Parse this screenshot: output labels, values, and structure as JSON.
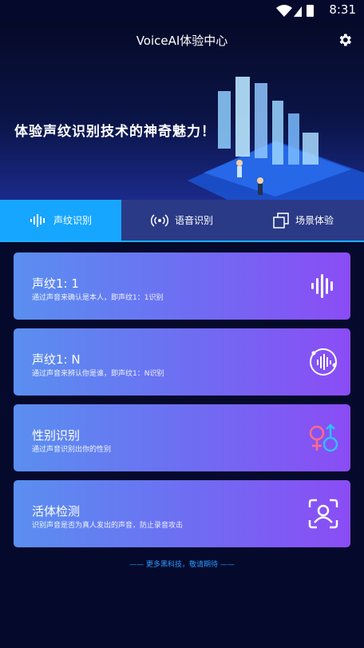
{
  "status": {
    "time": "8:31"
  },
  "header": {
    "title": "VoiceAI体验中心",
    "banner_text": "体验声纹识别技术的神奇魅力！"
  },
  "tabs": [
    {
      "label": "声纹识别",
      "icon": "soundwave-icon",
      "active": true
    },
    {
      "label": "语音识别",
      "icon": "broadcast-icon",
      "active": false
    },
    {
      "label": "场景体验",
      "icon": "layers-icon",
      "active": false
    }
  ],
  "cards": [
    {
      "title": "声纹1: 1",
      "desc": "通过声音来确认是本人，即声纹1：1识别",
      "icon": "soundwave-icon"
    },
    {
      "title": "声纹1: N",
      "desc": "通过声音来辨认你是谁，即声纹1：N识别",
      "icon": "circle-soundwave-icon"
    },
    {
      "title": "性别识别",
      "desc": "通过声音识别出你的性别",
      "icon": "gender-icon"
    },
    {
      "title": "活体检测",
      "desc": "识别声音是否为真人发出的声音，防止录音攻击",
      "icon": "face-scan-icon"
    }
  ],
  "footer": {
    "note": "—— 更多黑科技，敬请期待 ——"
  },
  "colors": {
    "active_tab": "#16a6ff",
    "tab_bar": "#2b3a86",
    "footer_text": "#2a9bff"
  }
}
